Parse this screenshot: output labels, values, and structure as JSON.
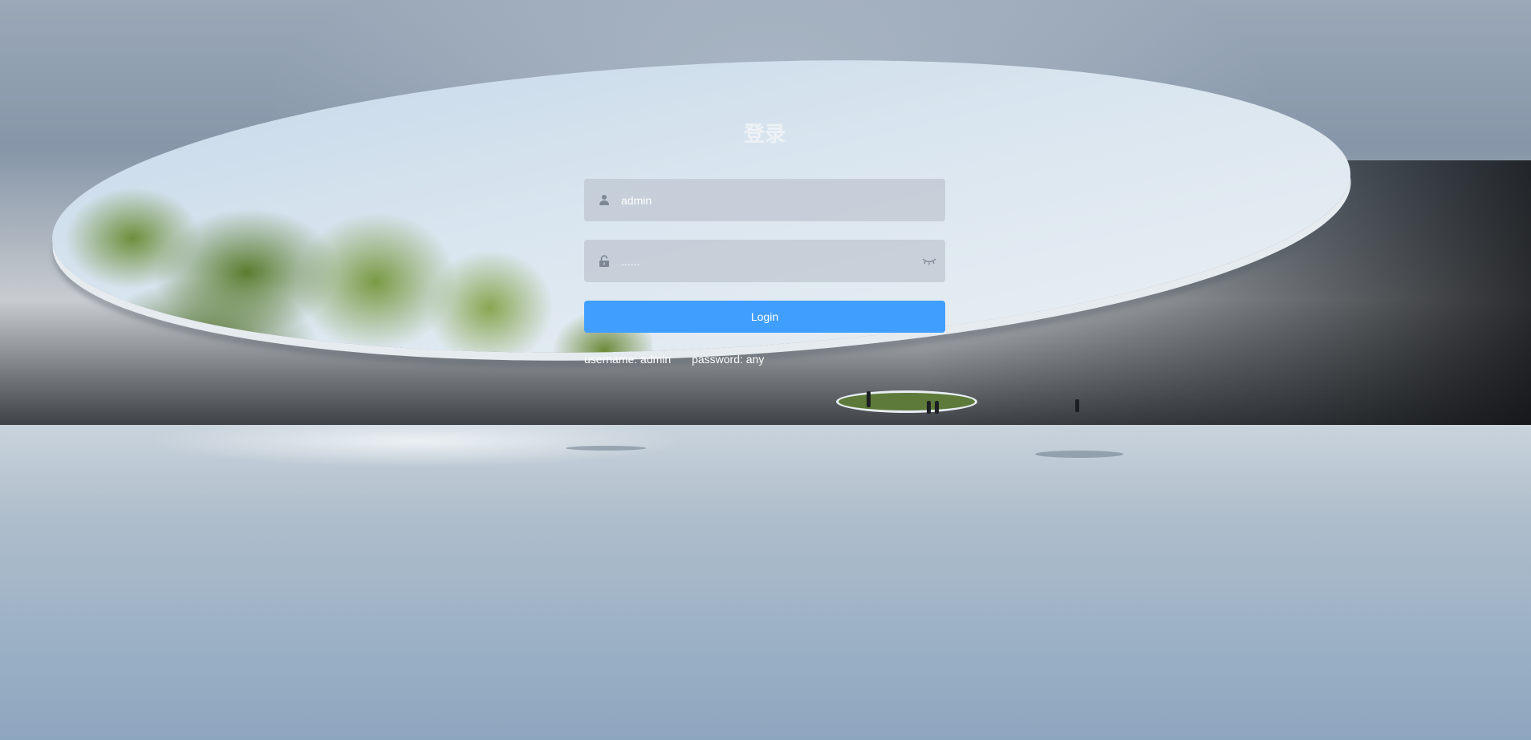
{
  "login": {
    "title": "登录",
    "username": {
      "value": "admin",
      "icon": "user-icon"
    },
    "password": {
      "value": "......",
      "icon": "lock-icon",
      "toggle_icon": "eye-closed-icon"
    },
    "submit_label": "Login",
    "tips": {
      "username": "username: admin",
      "password": "password: any"
    }
  },
  "colors": {
    "primary": "#409eff",
    "input_bg": "rgba(190,198,208,0.72)",
    "text": "#ffffff"
  }
}
